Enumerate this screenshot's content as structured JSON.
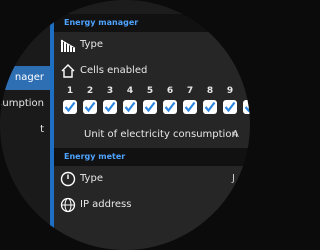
{
  "sidebar": {
    "items": [
      {
        "label": "nager",
        "active": true
      },
      {
        "label": "nsumption",
        "active": false
      },
      {
        "label": "t",
        "active": false
      }
    ]
  },
  "energy_manager": {
    "header": "Energy manager",
    "type_label": "Type",
    "cells_enabled_label": "Cells enabled",
    "cells": [
      {
        "number": "1",
        "checked": true
      },
      {
        "number": "2",
        "checked": true
      },
      {
        "number": "3",
        "checked": true
      },
      {
        "number": "4",
        "checked": true
      },
      {
        "number": "5",
        "checked": true
      },
      {
        "number": "6",
        "checked": true
      },
      {
        "number": "7",
        "checked": true
      },
      {
        "number": "8",
        "checked": true
      },
      {
        "number": "9",
        "checked": true
      },
      {
        "number": "",
        "checked": true
      }
    ],
    "unit_label": "Unit of electricity consumption",
    "unit_value": "A"
  },
  "energy_meter": {
    "header": "Energy meter",
    "type_label": "Type",
    "type_value": "J",
    "ip_label": "IP address"
  },
  "colors": {
    "accent": "#2e6fb4",
    "header_text": "#4ea3ff"
  }
}
